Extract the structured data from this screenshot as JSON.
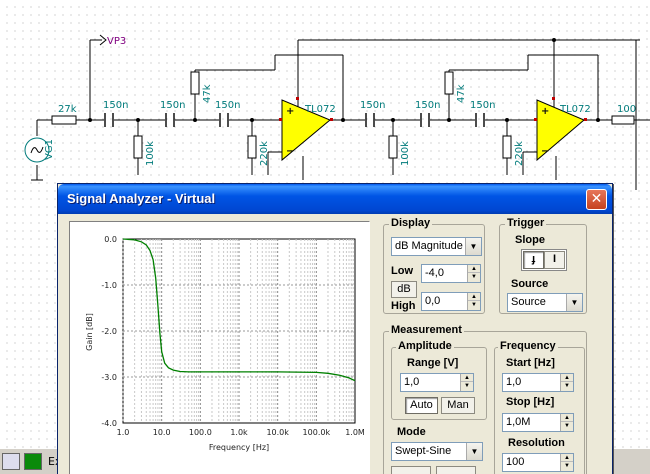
{
  "schematic": {
    "components": {
      "r_in": "27k",
      "c1": "150n",
      "c2": "150n",
      "c3": "150n",
      "r_gnd1": "100k",
      "r_fb1": "47k",
      "r_gnd2": "220k",
      "opamp1": "TL072",
      "c4": "150n",
      "c5": "150n",
      "c6": "150n",
      "r_gnd3": "100k",
      "r_fb2": "47k",
      "r_gnd4": "220k",
      "opamp2": "TL072",
      "r_out": "100",
      "source": "VG1",
      "probe": "VP3"
    }
  },
  "window": {
    "title": "Signal Analyzer - Virtual",
    "close": "✕"
  },
  "taskbar": {
    "item_label": "Ex"
  },
  "display": {
    "group_label": "Display",
    "mode": "dB Magnitude",
    "low_label": "Low",
    "low_value": "-4,0",
    "db_button": "dB",
    "high_label": "High",
    "high_value": "0,0"
  },
  "trigger": {
    "group_label": "Trigger",
    "slope_label": "Slope",
    "source_label": "Source",
    "source_value": "Source"
  },
  "measurement": {
    "group_label": "Measurement",
    "amplitude_label": "Amplitude",
    "range_label": "Range [V]",
    "range_value": "1,0",
    "auto_button": "Auto",
    "man_button": "Man",
    "mode_label": "Mode",
    "mode_value": "Swept-Sine"
  },
  "frequency": {
    "group_label": "Frequency",
    "start_label": "Start [Hz]",
    "start_value": "1,0",
    "stop_label": "Stop [Hz]",
    "stop_value": "1,0M",
    "resolution_label": "Resolution",
    "resolution_value": "100"
  },
  "chart_data": {
    "type": "line",
    "xlabel": "Frequency [Hz]",
    "ylabel": "Gain [dB]",
    "x_scale": "log",
    "xlim": [
      1,
      1000000
    ],
    "ylim": [
      -4.0,
      0.0
    ],
    "grid": true,
    "x_tick_labels": [
      "1.0",
      "10.0",
      "100.0",
      "1.0k",
      "10.0k",
      "100.0k",
      "1.0M"
    ],
    "y_tick_labels": [
      "0.0",
      "-1.0",
      "-2.0",
      "-3.0",
      "-4.0"
    ],
    "series": [
      {
        "color": "#008000",
        "x": [
          1,
          2,
          3,
          4,
          5,
          6,
          7,
          8,
          9,
          10,
          12,
          15,
          20,
          30,
          50,
          100,
          1000,
          10000,
          100000,
          200000,
          400000,
          700000,
          1000000
        ],
        "y": [
          0.0,
          -0.02,
          -0.06,
          -0.13,
          -0.25,
          -0.45,
          -0.85,
          -1.45,
          -2.05,
          -2.45,
          -2.7,
          -2.8,
          -2.85,
          -2.88,
          -2.89,
          -2.89,
          -2.89,
          -2.89,
          -2.9,
          -2.92,
          -2.96,
          -3.02,
          -3.08
        ]
      }
    ]
  }
}
